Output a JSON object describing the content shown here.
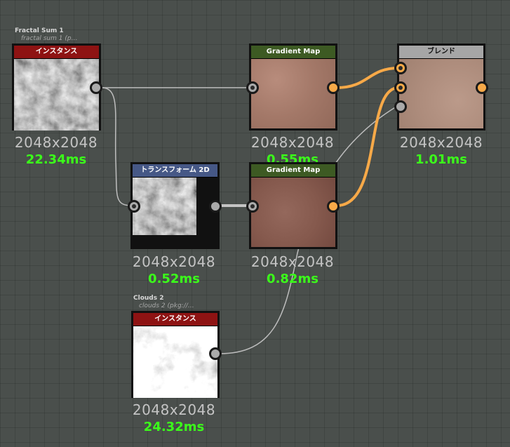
{
  "wire_colors": {
    "gray": "#bdbdbd",
    "orange": "#f7a948"
  },
  "nodes": {
    "fractal": {
      "title": "Fractal Sum 1",
      "subtitle": "fractal sum 1 (p…",
      "header": "インスタンス",
      "header_color": "#8e1313",
      "texture": "noise-dark",
      "size": "2048x2048",
      "time": "22.34ms"
    },
    "gradient1": {
      "header": "Gradient Map",
      "header_color": "#3d5a23",
      "texture": "skin",
      "size": "2048x2048",
      "time": "0.55ms"
    },
    "blend": {
      "header": "ブレンド",
      "header_color": "#a6a6a6",
      "texture": "skin-light",
      "size": "2048x2048",
      "time": "1.01ms"
    },
    "transform": {
      "header": "トランスフォーム 2D",
      "header_color": "#465886",
      "texture": "noise-dark",
      "size": "2048x2048",
      "time": "0.52ms"
    },
    "gradient2": {
      "header": "Gradient Map",
      "header_color": "#3d5a23",
      "texture": "skin-dark",
      "size": "2048x2048",
      "time": "0.82ms"
    },
    "clouds": {
      "title": "Clouds 2",
      "subtitle": "clouds 2 (pkg://…",
      "header": "インスタンス",
      "header_color": "#8e1313",
      "texture": "clouds",
      "size": "2048x2048",
      "time": "24.32ms"
    }
  }
}
